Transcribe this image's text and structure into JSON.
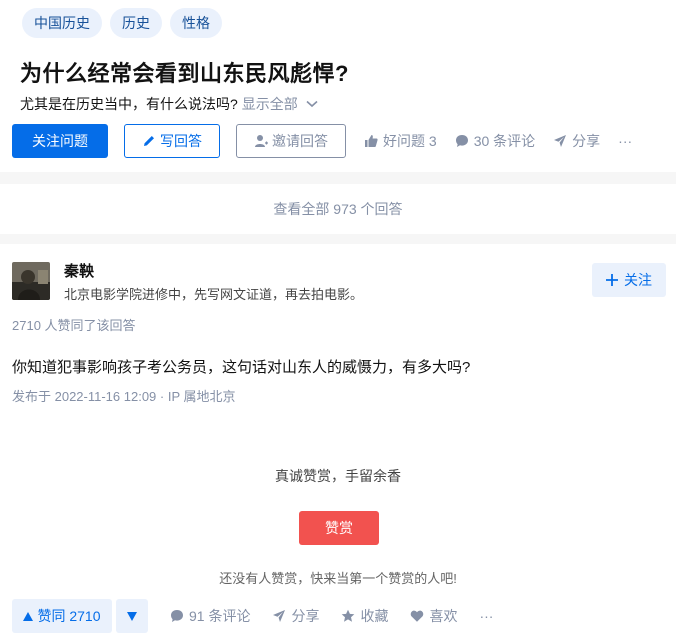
{
  "question": {
    "tags": [
      "中国历史",
      "历史",
      "性格"
    ],
    "title": "为什么经常会看到山东民风彪悍?",
    "detail": "尤其是在历史当中，有什么说法吗?",
    "show_all": "显示全部"
  },
  "actions": {
    "follow_question": "关注问题",
    "write_answer": "写回答",
    "invite_answer": "邀请回答",
    "good_question": "好问题 3",
    "comments": "30 条评论",
    "share": "分享",
    "more": "···"
  },
  "view_all_answers": "查看全部 973 个回答",
  "answer": {
    "author_name": "秦鞅",
    "author_bio": "北京电影学院进修中，先写网文证道，再去拍电影。",
    "follow_label": "关注",
    "voters": "2710 人赞同了该回答",
    "text": "你知道犯事影响孩子考公务员，这句话对山东人的威慑力，有多大吗?",
    "meta": "发布于 2022-11-16 12:09 · IP 属地北京"
  },
  "reward": {
    "slogan": "真诚赞赏，手留余香",
    "button": "赞赏",
    "note": "还没有人赞赏，快来当第一个赞赏的人吧!"
  },
  "bottom_bar": {
    "upvote": "赞同 2710",
    "comments": "91 条评论",
    "share": "分享",
    "collect": "收藏",
    "like": "喜欢",
    "more": "···"
  },
  "colors": {
    "brand_blue": "#056de8",
    "tag_bg": "#eaf1fc",
    "muted": "#8590a6",
    "reward_red": "#f1403c"
  }
}
